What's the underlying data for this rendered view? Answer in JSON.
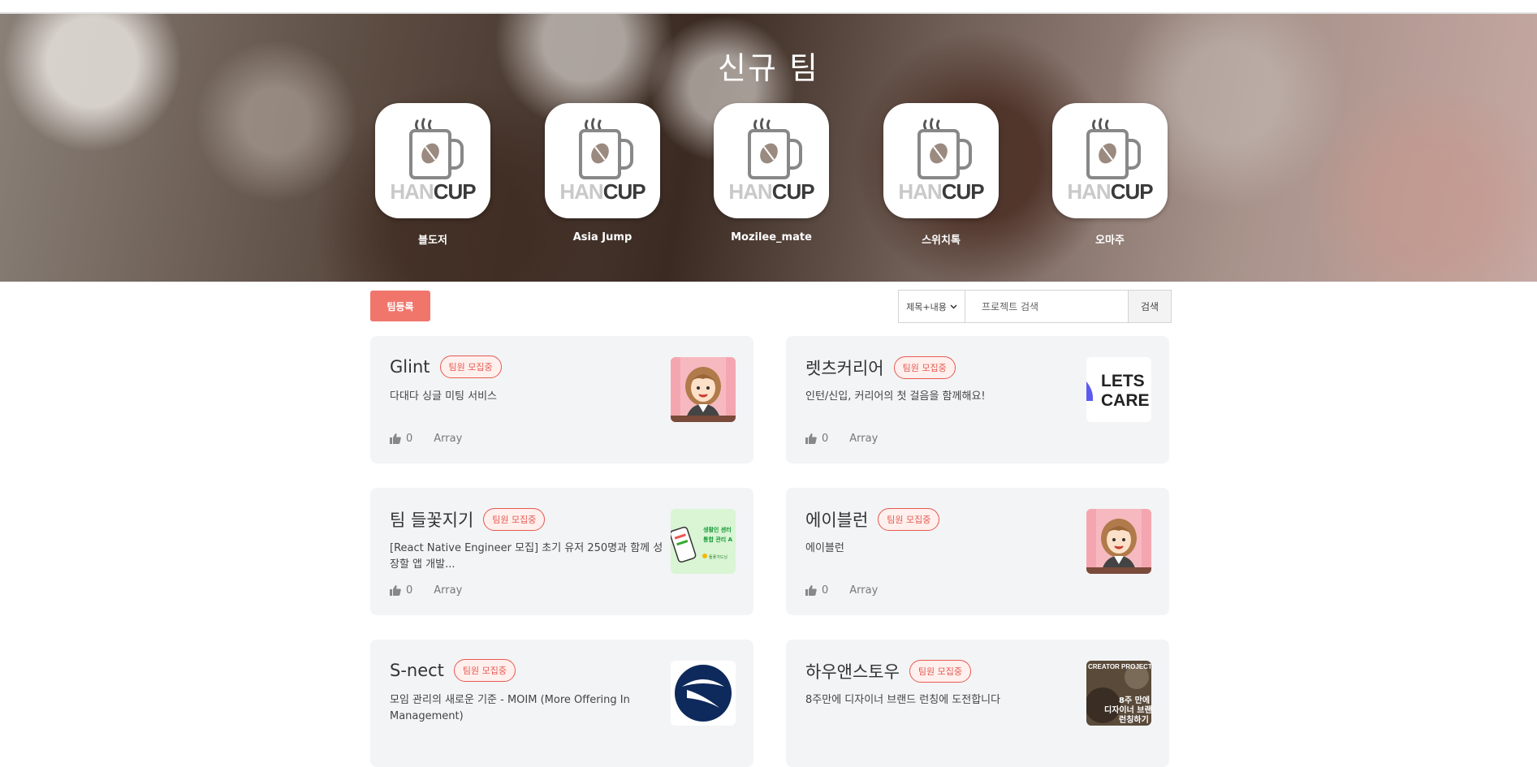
{
  "topbar": {
    "cut_text": ""
  },
  "hero": {
    "title": "신규 팀",
    "teams": [
      {
        "name": "블도저",
        "logo": "hancup-logo"
      },
      {
        "name": "Asia Jump",
        "logo": "hancup-logo"
      },
      {
        "name": "Mozilee_mate",
        "logo": "hancup-logo"
      },
      {
        "name": "스위치톡",
        "logo": "hancup-logo"
      },
      {
        "name": "오마주",
        "logo": "hancup-logo"
      }
    ],
    "logo_text_han": "HAN",
    "logo_text_cup": "CUP"
  },
  "toolbar": {
    "register_label": "팀등록",
    "search_scope": "제목+내용",
    "search_placeholder": "프로젝트 검색",
    "search_button": "검색"
  },
  "cards": [
    {
      "title": "Glint",
      "badge": "팀원 모집중",
      "desc": "다대다 싱글 미팅 서비스",
      "likes": "0",
      "tag": "Array",
      "thumb": "avatar-woman"
    },
    {
      "title": "렛츠커리어",
      "badge": "팀원 모집중",
      "desc": "인턴/신입, 커리어의 첫 걸음을 함께해요!",
      "likes": "0",
      "tag": "Array",
      "thumb": "lets-care-logo",
      "thumb_text1": "LETS",
      "thumb_text2": "CARE"
    },
    {
      "title": "팀 들꽃지기",
      "badge": "팀원 모집중",
      "desc": "[React Native Engineer 모집] 초기 유저 250명과 함께 성장할 앱 개발...",
      "likes": "0",
      "tag": "Array",
      "thumb": "app-promo",
      "thumb_text1": "생활인 센터",
      "thumb_text2": "통합 관리 A",
      "thumb_text3": "들꽃가드닝"
    },
    {
      "title": "에이블런",
      "badge": "팀원 모집중",
      "desc": "에이블런",
      "likes": "0",
      "tag": "Array",
      "thumb": "avatar-woman"
    },
    {
      "title": "S-nect",
      "badge": "팀원 모집중",
      "desc": "모임 관리의 새로운 기준 - MOIM (More Offering In Management)",
      "likes": "",
      "tag": "",
      "thumb": "snect-logo"
    },
    {
      "title": "하우앤스토우",
      "badge": "팀원 모집중",
      "desc": "8주만에 디자이너 브랜드 런칭에 도전합니다",
      "likes": "",
      "tag": "",
      "thumb": "creator-project",
      "thumb_text1": "CREATOR PROJECT",
      "thumb_text2": "8주 만에",
      "thumb_text3": "디자이너 브랜드",
      "thumb_text4": "런칭하기"
    }
  ],
  "colors": {
    "accent": "#f0766c",
    "badge": "#e55a51",
    "card_bg": "#f3f4f6"
  }
}
